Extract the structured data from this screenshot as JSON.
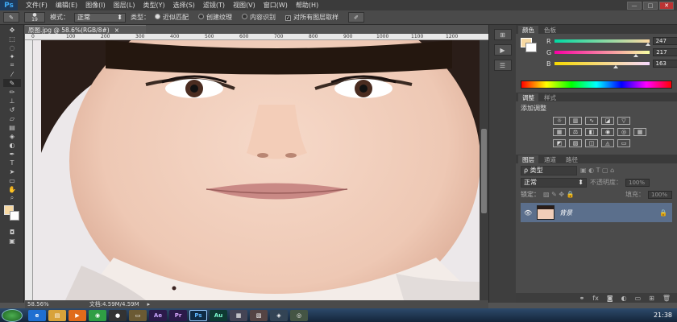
{
  "app": {
    "logo": "Ps"
  },
  "menu": [
    "文件(F)",
    "编辑(E)",
    "图像(I)",
    "图层(L)",
    "类型(Y)",
    "选择(S)",
    "滤镜(T)",
    "视图(V)",
    "窗口(W)",
    "帮助(H)"
  ],
  "window_controls": {
    "minimize": "—",
    "restore": "□",
    "close": "✕"
  },
  "options": {
    "brush_size": "19",
    "mode_label": "模式：",
    "mode_value": "正常",
    "type_label": "类型：",
    "radio_proximity": "近似匹配",
    "radio_texture": "创建纹理",
    "radio_content": "内容识别",
    "sample_all_layers": "对所有图层取样"
  },
  "document": {
    "tab_title": "原图.jpg @ 58.6%(RGB/8#)",
    "tab_close": "×",
    "zoom": "58.56%",
    "doc_info": "文档:4.59M/4.59M"
  },
  "ruler_labels": [
    "0",
    "100",
    "200",
    "300",
    "400",
    "500",
    "600",
    "700",
    "800",
    "900",
    "1000",
    "1100",
    "1200"
  ],
  "color_panel": {
    "tabs": [
      "颜色",
      "色板"
    ],
    "r_label": "R",
    "g_label": "G",
    "b_label": "B",
    "r": "247",
    "g": "217",
    "b": "163",
    "fg_color": "#f7d9a3"
  },
  "adjust_panel": {
    "tabs": [
      "调整",
      "样式"
    ],
    "title": "添加调整"
  },
  "layers_panel": {
    "tabs": [
      "图层",
      "通道",
      "路径"
    ],
    "filter": "ρ 类型",
    "blend_mode": "正常",
    "opacity_label": "不透明度：",
    "opacity": "100%",
    "lock_label": "锁定：",
    "fill_label": "填充：",
    "fill": "100%",
    "layer_name": "背景"
  },
  "taskbar": {
    "apps": [
      "Ae",
      "Pr",
      "Ps",
      "Au"
    ],
    "time": "21:38"
  }
}
